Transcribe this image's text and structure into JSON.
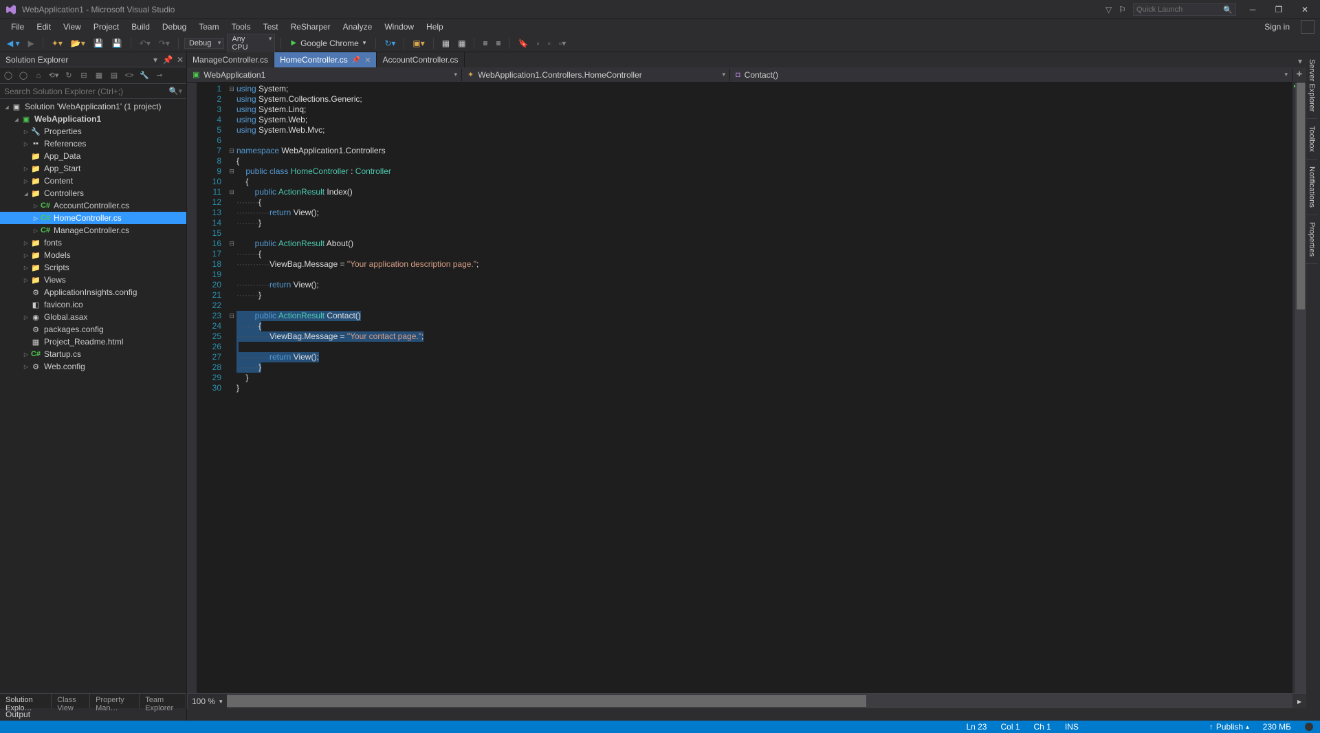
{
  "titlebar": {
    "title": "WebApplication1 - Microsoft Visual Studio",
    "quick_launch_placeholder": "Quick Launch"
  },
  "menu": [
    "File",
    "Edit",
    "View",
    "Project",
    "Build",
    "Debug",
    "Team",
    "Tools",
    "Test",
    "ReSharper",
    "Analyze",
    "Window",
    "Help"
  ],
  "signin": "Sign in",
  "toolbar": {
    "config": "Debug",
    "platform": "Any CPU",
    "browser": "Google Chrome"
  },
  "solution_explorer": {
    "title": "Solution Explorer",
    "search_placeholder": "Search Solution Explorer (Ctrl+;)",
    "solution_label": "Solution 'WebApplication1' (1 project)",
    "project": "WebApplication1",
    "nodes": {
      "properties": "Properties",
      "references": "References",
      "app_data": "App_Data",
      "app_start": "App_Start",
      "content": "Content",
      "controllers": "Controllers",
      "account_ctrl": "AccountController.cs",
      "home_ctrl": "HomeController.cs",
      "manage_ctrl": "ManageController.cs",
      "fonts": "fonts",
      "models": "Models",
      "scripts": "Scripts",
      "views": "Views",
      "appinsights": "ApplicationInsights.config",
      "favicon": "favicon.ico",
      "global": "Global.asax",
      "packages": "packages.config",
      "readme": "Project_Readme.html",
      "startup": "Startup.cs",
      "webconfig": "Web.config"
    },
    "tabs": [
      "Solution Explo…",
      "Class View",
      "Property Man…",
      "Team Explorer"
    ]
  },
  "doc_tabs": [
    {
      "label": "ManageController.cs",
      "active": false
    },
    {
      "label": "HomeController.cs",
      "active": true
    },
    {
      "label": "AccountController.cs",
      "active": false
    }
  ],
  "nav": {
    "project": "WebApplication1",
    "class": "WebApplication1.Controllers.HomeController",
    "member": "Contact()"
  },
  "right_tabs": [
    "Server Explorer",
    "Toolbox",
    "Notifications",
    "Properties"
  ],
  "zoom": "100 %",
  "output_label": "Output",
  "status": {
    "line": "Ln 23",
    "col": "Col 1",
    "ch": "Ch 1",
    "ins": "INS",
    "publish": "Publish",
    "mem": "230 МБ"
  },
  "code": {
    "lines": [
      {
        "n": 1,
        "fold": "-",
        "html": "<span class='kw'>using</span> <span class='plain'>System;</span>"
      },
      {
        "n": 2,
        "fold": "",
        "html": "<span class='kw'>using</span> <span class='plain'>System.Collections.Generic;</span>"
      },
      {
        "n": 3,
        "fold": "",
        "html": "<span class='kw'>using</span> <span class='plain'>System.Linq;</span>"
      },
      {
        "n": 4,
        "fold": "",
        "html": "<span class='kw'>using</span> <span class='plain'>System.Web;</span>"
      },
      {
        "n": 5,
        "fold": "",
        "html": "<span class='kw'>using</span> <span class='plain'>System.Web.Mvc;</span>"
      },
      {
        "n": 6,
        "fold": "",
        "html": ""
      },
      {
        "n": 7,
        "fold": "-",
        "html": "<span class='kw'>namespace</span> <span class='plain'>WebApplication1.Controllers</span>"
      },
      {
        "n": 8,
        "fold": "",
        "html": "<span class='plain'>{</span>"
      },
      {
        "n": 9,
        "fold": "-",
        "html": "    <span class='kw'>public</span> <span class='kw'>class</span> <span class='type'>HomeController</span> <span class='plain'>:</span> <span class='type'>Controller</span>"
      },
      {
        "n": 10,
        "fold": "",
        "html": "    <span class='plain'>{</span>"
      },
      {
        "n": 11,
        "fold": "-",
        "html": "        <span class='kw'>public</span> <span class='type'>ActionResult</span> <span class='plain'>Index()</span>"
      },
      {
        "n": 12,
        "fold": "",
        "html": "<span class='dots'>········</span><span class='plain'>{</span>"
      },
      {
        "n": 13,
        "fold": "",
        "html": "<span class='dots'>············</span><span class='kw'>return</span> <span class='plain'>View();</span>"
      },
      {
        "n": 14,
        "fold": "",
        "html": "<span class='dots'>········</span><span class='plain'>}</span>"
      },
      {
        "n": 15,
        "fold": "",
        "html": ""
      },
      {
        "n": 16,
        "fold": "-",
        "html": "        <span class='kw'>public</span> <span class='type'>ActionResult</span> <span class='plain'>About()</span>"
      },
      {
        "n": 17,
        "fold": "",
        "html": "<span class='dots'>········</span><span class='plain'>{</span>"
      },
      {
        "n": 18,
        "fold": "",
        "html": "<span class='dots'>············</span><span class='plain'>ViewBag.Message = </span><span class='str'>\"Your application description page.\"</span><span class='plain'>;</span>"
      },
      {
        "n": 19,
        "fold": "",
        "html": ""
      },
      {
        "n": 20,
        "fold": "",
        "html": "<span class='dots'>············</span><span class='kw'>return</span> <span class='plain'>View();</span>"
      },
      {
        "n": 21,
        "fold": "",
        "html": "<span class='dots'>········</span><span class='plain'>}</span>"
      },
      {
        "n": 22,
        "fold": "",
        "html": ""
      },
      {
        "n": 23,
        "fold": "-",
        "html": "<span class='sel'>        <span class='kw'>public</span> <span class='type'>ActionResult</span> <span class='plain'>Contact()</span></span>",
        "selected": true
      },
      {
        "n": 24,
        "fold": "",
        "html": "<span class='sel'><span class='dots'>········</span><span class='plain'>{</span></span>",
        "selected": true
      },
      {
        "n": 25,
        "fold": "",
        "html": "<span class='sel'><span class='dots'>············</span><span class='plain'>ViewBag.Message = </span><span class='str'>\"Your contact page.\"</span><span class='plain'>;</span></span>",
        "selected": true
      },
      {
        "n": 26,
        "fold": "",
        "html": "<span class='sel'> </span>",
        "selected": true
      },
      {
        "n": 27,
        "fold": "",
        "html": "<span class='sel'><span class='dots'>············</span><span class='kw'>return</span> <span class='plain'>View();</span></span>",
        "selected": true
      },
      {
        "n": 28,
        "fold": "",
        "html": "<span class='sel'><span class='dots'>········</span><span class='plain'>}</span></span>",
        "selected": true
      },
      {
        "n": 29,
        "fold": "",
        "html": "    <span class='plain'>}</span>"
      },
      {
        "n": 30,
        "fold": "",
        "html": "<span class='plain'>}</span>"
      }
    ]
  }
}
